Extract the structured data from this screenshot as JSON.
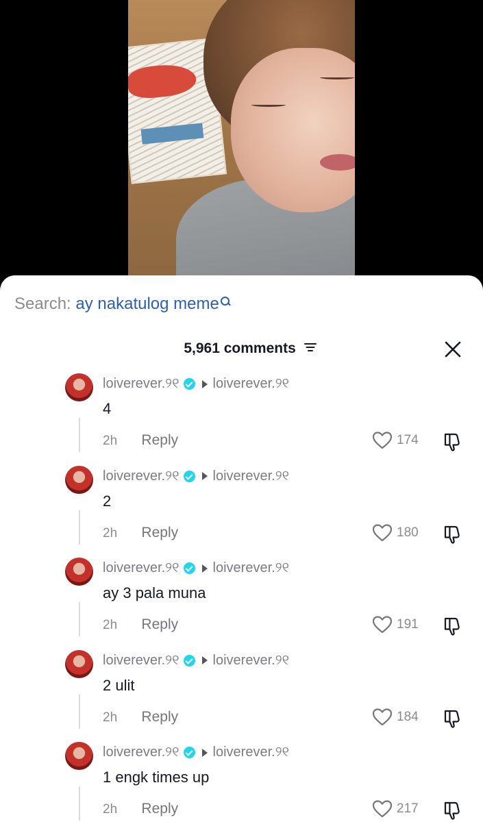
{
  "search": {
    "prefix": "Search:",
    "query": "ay nakatulog meme"
  },
  "header": {
    "comment_count": "5,961 comments"
  },
  "comments": [
    {
      "username": "loiverever.୨୧",
      "reply_to": "loiverever.୨୧",
      "text": "4",
      "time": "2h",
      "reply_label": "Reply",
      "likes": "174"
    },
    {
      "username": "loiverever.୨୧",
      "reply_to": "loiverever.୨୧",
      "text": "2",
      "time": "2h",
      "reply_label": "Reply",
      "likes": "180"
    },
    {
      "username": "loiverever.୨୧",
      "reply_to": "loiverever.୨୧",
      "text": "ay 3 pala muna",
      "time": "2h",
      "reply_label": "Reply",
      "likes": "191"
    },
    {
      "username": "loiverever.୨୧",
      "reply_to": "loiverever.୨୧",
      "text": "2 ulit",
      "time": "2h",
      "reply_label": "Reply",
      "likes": "184"
    },
    {
      "username": "loiverever.୨୧",
      "reply_to": "loiverever.୨୧",
      "text": "1 engk times up",
      "time": "2h",
      "reply_label": "Reply",
      "likes": "217"
    }
  ],
  "icons": {
    "search": "search-icon",
    "filter": "filter-icon",
    "close": "close-icon",
    "verified": "verified-icon",
    "reply_arrow": "reply-arrow-icon",
    "like": "heart-icon",
    "dislike": "dislike-icon"
  },
  "colors": {
    "search_query": "#2b5fb3",
    "verified": "#20d5ec",
    "text_primary": "#161823",
    "text_secondary": "#8a8b91"
  }
}
